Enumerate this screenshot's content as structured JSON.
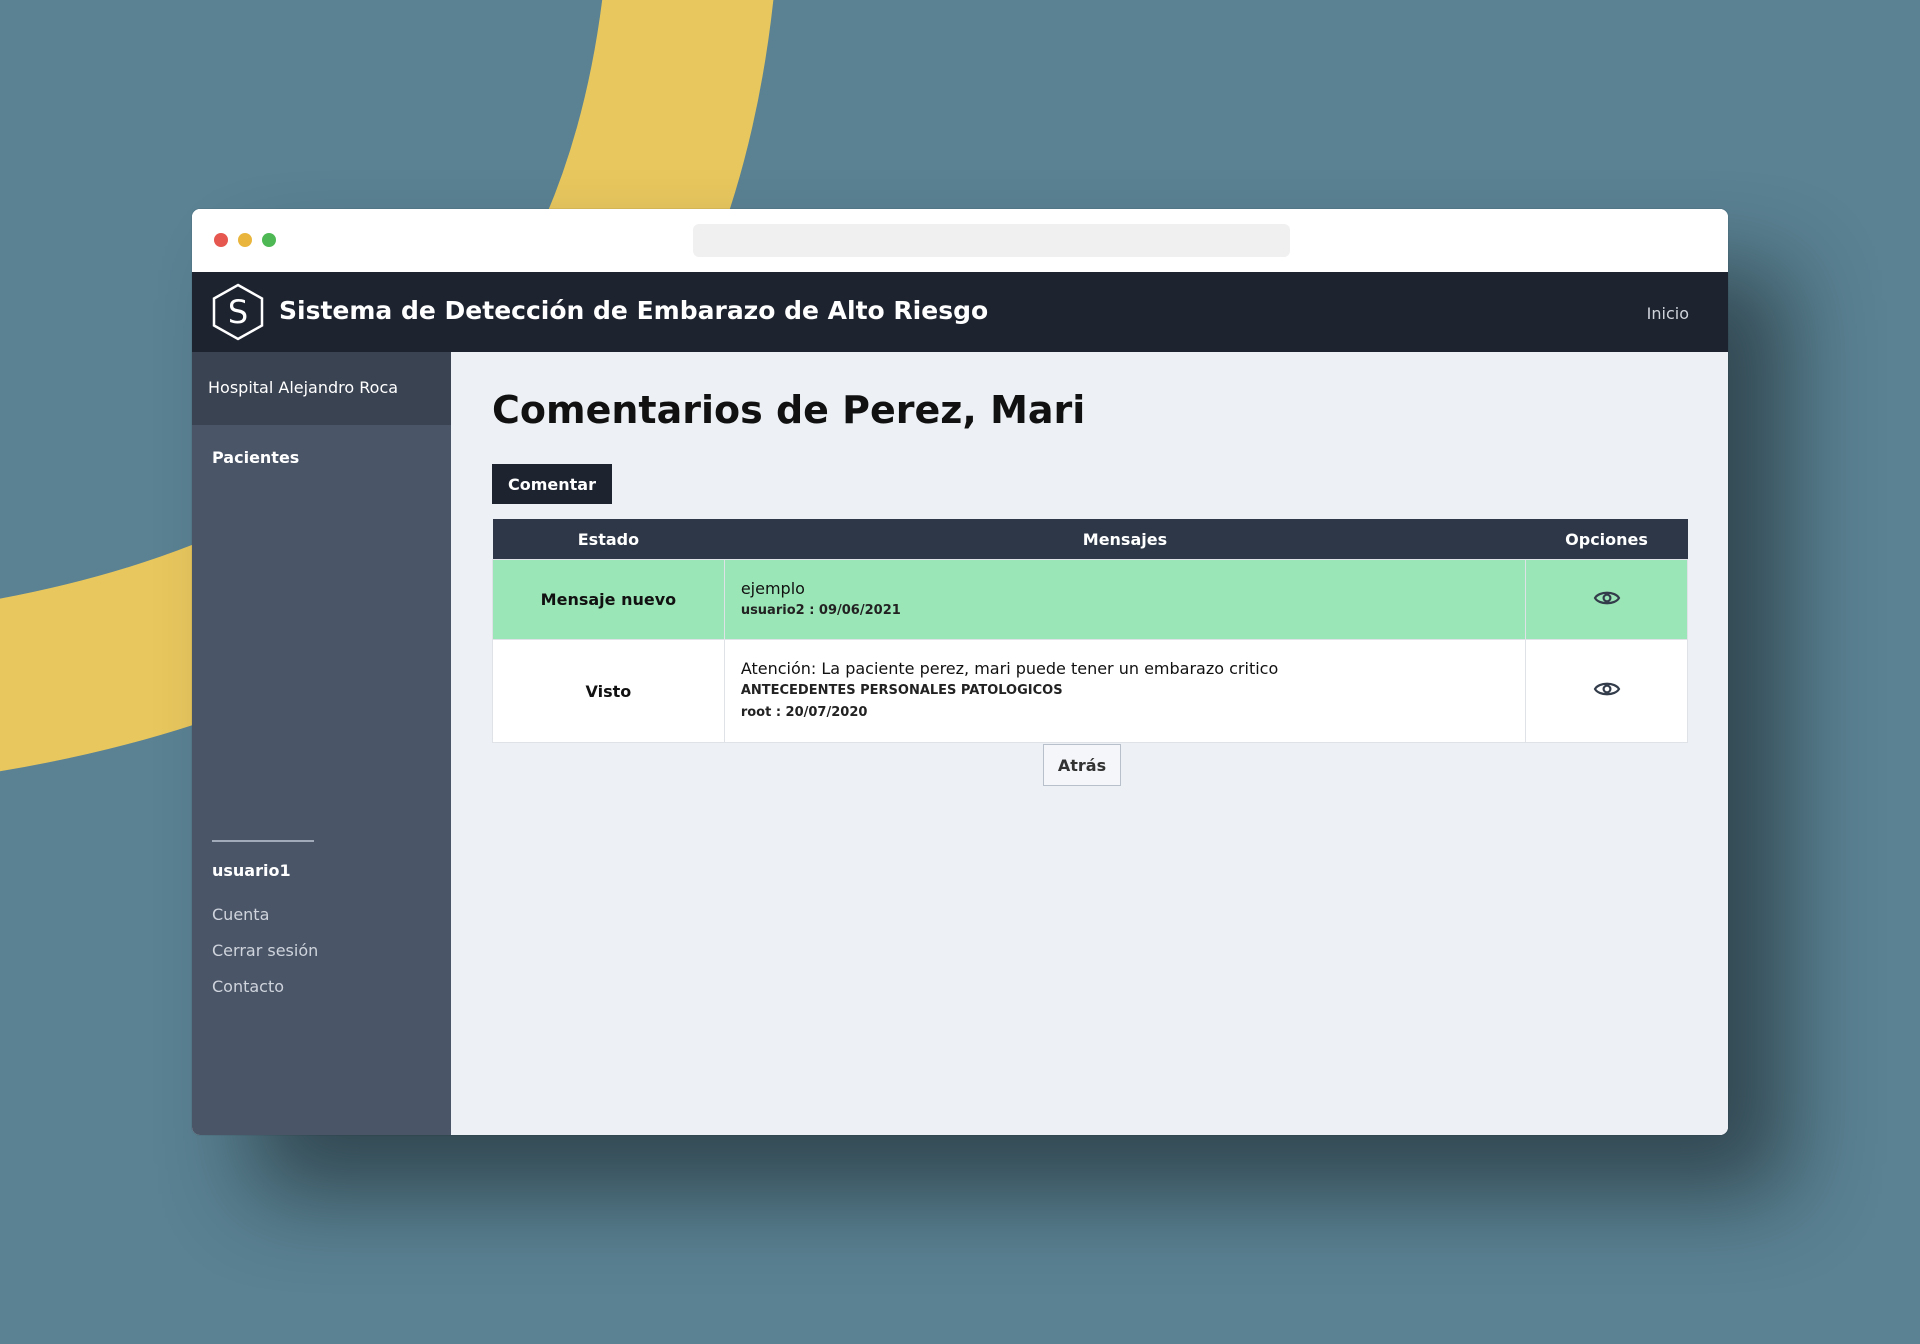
{
  "header": {
    "logo_letter": "S",
    "title": "Sistema de Detección de Embarazo de Alto Riesgo",
    "nav_inicio": "Inicio"
  },
  "sidebar": {
    "hospital": "Hospital Alejandro Roca",
    "section": "Pacientes",
    "user": "usuario1",
    "links": [
      "Cuenta",
      "Cerrar sesión",
      "Contacto"
    ]
  },
  "main": {
    "title": "Comentarios de Perez, Mari",
    "comment_button": "Comentar",
    "table": {
      "headers": [
        "Estado",
        "Mensajes",
        "Opciones"
      ],
      "rows": [
        {
          "estado": "Mensaje nuevo",
          "message": "ejemplo",
          "meta": "usuario2 : 09/06/2021",
          "row_color": "#9be6b7",
          "option_icon": "eye-icon"
        },
        {
          "estado": "Visto",
          "message": "Atención: La paciente perez, mari puede tener un embarazo critico",
          "category": "ANTECEDENTES PERSONALES PATOLOGICOS",
          "meta": "root : 20/07/2020",
          "row_color": "#ffffff",
          "option_icon": "eye-icon"
        }
      ]
    },
    "back_button": "Atrás"
  },
  "colors": {
    "background": "#5a8293",
    "accent_yellow": "#e8c75e",
    "header": "#1e2330",
    "sidebar": "#4a5568",
    "new_message": "#9be6b7"
  }
}
